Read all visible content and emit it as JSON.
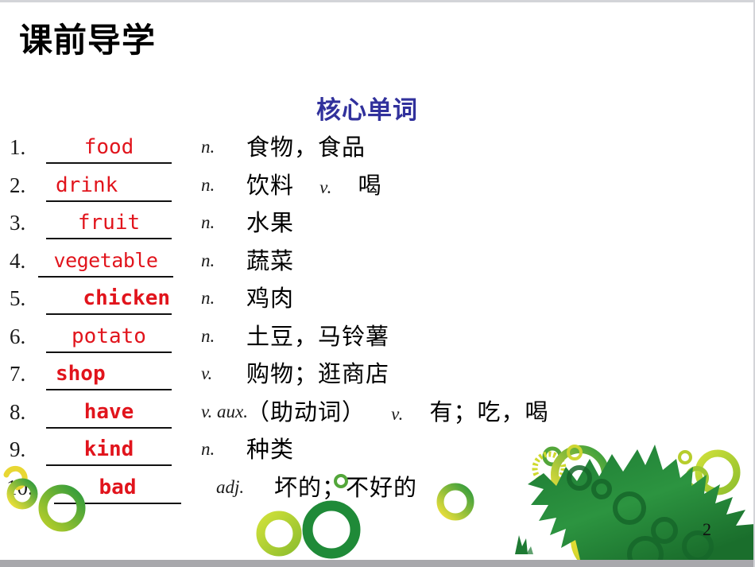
{
  "slide": {
    "title": "课前导学",
    "section_heading": "核心单词",
    "page_number": "2"
  },
  "colors": {
    "answer_red": "#e1141c",
    "heading_blue": "#31319c",
    "title_black": "#000000",
    "leaf_green_dark": "#1f7a32",
    "leaf_green_mid": "#2f9a3c",
    "ring_yellow_green": "#c8d42a",
    "bottom_bar_gray": "#a8a8ac"
  },
  "words": [
    {
      "index": "1.",
      "answer": "food",
      "pos": "n.",
      "meaning": "食物，食品",
      "pos2": "",
      "meaning2": ""
    },
    {
      "index": "2.",
      "answer": "drink",
      "pos": "n.",
      "meaning": "饮料",
      "pos2": "v.",
      "meaning2": "喝"
    },
    {
      "index": "3.",
      "answer": "fruit",
      "pos": "n.",
      "meaning": "水果",
      "pos2": "",
      "meaning2": ""
    },
    {
      "index": "4.",
      "answer": "vegetable",
      "pos": "n.",
      "meaning": "蔬菜",
      "pos2": "",
      "meaning2": ""
    },
    {
      "index": "5.",
      "answer": "chicken",
      "pos": "n.",
      "meaning": "鸡肉",
      "pos2": "",
      "meaning2": ""
    },
    {
      "index": "6.",
      "answer": "potato",
      "pos": "n.",
      "meaning": "土豆，马铃薯",
      "pos2": "",
      "meaning2": ""
    },
    {
      "index": "7.",
      "answer": "shop",
      "pos": "v.",
      "meaning": "购物；逛商店",
      "pos2": "",
      "meaning2": ""
    },
    {
      "index": "8.",
      "answer": "have",
      "pos": "v. aux.",
      "meaning": "（助动词）",
      "pos2": "v.",
      "meaning2": "有；吃，喝"
    },
    {
      "index": "9.",
      "answer": "kind",
      "pos": "n.",
      "meaning": "种类",
      "pos2": "",
      "meaning2": ""
    },
    {
      "index": "10.",
      "answer": "bad",
      "pos": "adj.",
      "meaning": "坏的；不好的",
      "pos2": "",
      "meaning2": ""
    }
  ]
}
